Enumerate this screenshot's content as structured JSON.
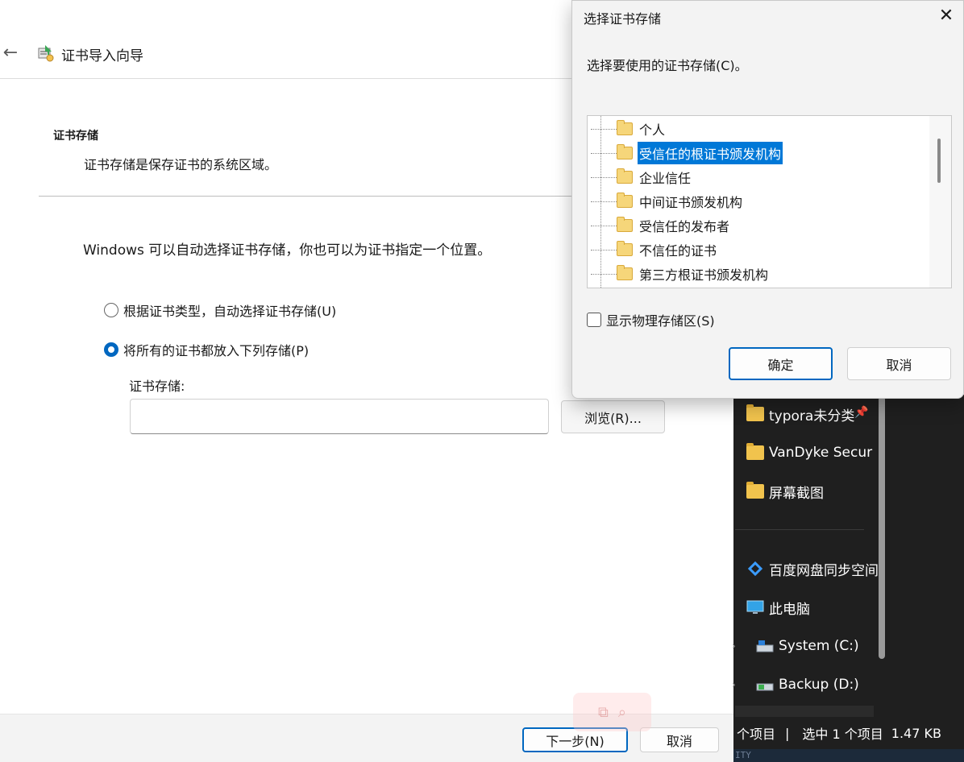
{
  "wizard": {
    "title": "证书导入向导",
    "section_title": "证书存储",
    "section_desc": "证书存储是保存证书的系统区域。",
    "intro": "Windows 可以自动选择证书存储，你也可以为证书指定一个位置。",
    "radio_auto_label": "根据证书类型，自动选择证书存储(U)",
    "radio_manual_label": "将所有的证书都放入下列存储(P)",
    "radio_selected": "manual",
    "store_label": "证书存储:",
    "store_value": "",
    "browse_label": "浏览(R)...",
    "next_label": "下一步(N)",
    "cancel_label": "取消"
  },
  "dialog": {
    "title": "选择证书存储",
    "close_glyph": "✕",
    "prompt": "选择要使用的证书存储(C)。",
    "stores": [
      {
        "label": "个人",
        "selected": false
      },
      {
        "label": "受信任的根证书颁发机构",
        "selected": true
      },
      {
        "label": "企业信任",
        "selected": false
      },
      {
        "label": "中间证书颁发机构",
        "selected": false
      },
      {
        "label": "受信任的发布者",
        "selected": false
      },
      {
        "label": "不信任的证书",
        "selected": false
      },
      {
        "label": "第三方根证书颁发机构",
        "selected": false
      }
    ],
    "show_physical_label": "显示物理存储区(S)",
    "show_physical_checked": false,
    "ok_label": "确定",
    "cancel_label": "取消"
  },
  "explorer": {
    "nav": {
      "typora": "typora未分类",
      "vandyke": "VanDyke Secur",
      "screens": "屏幕截图",
      "baidu": "百度网盘同步空间",
      "thispc": "此电脑",
      "sysc": "System (C:)",
      "backupd": "Backup (D:)"
    },
    "status": {
      "items": "个项目",
      "sep": "|",
      "selected": "选中 1 个项目",
      "size": "1.47 KB"
    },
    "bottom_text": "ITY"
  },
  "colors": {
    "accent": "#0067c0",
    "selection": "#0078d7",
    "explorer_bg": "#1f1f1f",
    "folder": "#f1c34d"
  }
}
